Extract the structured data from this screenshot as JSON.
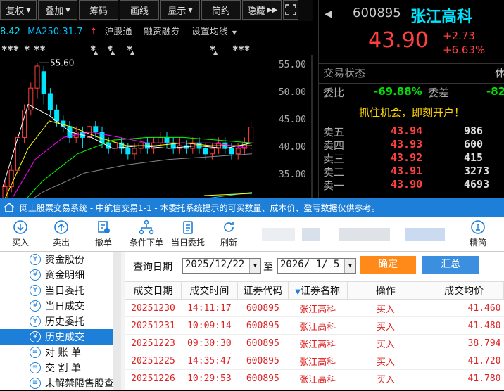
{
  "toolbar": {
    "items": [
      "复权",
      "叠加",
      "筹码",
      "画线",
      "显示",
      "简约",
      "隐藏"
    ],
    "more": "▶▶"
  },
  "ma_line": {
    "ma_partial": "8.42",
    "ma250": "MA250:31.7",
    "tabs": [
      "沪股通",
      "融资融券",
      "设置均线"
    ]
  },
  "chart": {
    "high_marker": "55.60",
    "price_ticks": [
      "55.00",
      "50.00",
      "45.00",
      "40.00",
      "35.00"
    ],
    "colors": {
      "up": "#ff4040",
      "down": "#00e5ff",
      "ma5": "#ffffff",
      "ma10": "#ffff00",
      "ma20": "#ff00ff",
      "ma60": "#00ff00",
      "ma250": "#00bfff"
    }
  },
  "quote": {
    "code": "600895",
    "name": "张江高科",
    "price": "43.90",
    "change": "+2.73",
    "change_pct": "+6.63%",
    "status_label": "交易状态",
    "status_value": "休",
    "weibi_label": "委比",
    "weibi_value": "-69.88%",
    "weicha_label": "委差",
    "weicha_value": "-82",
    "ad_text": "抓住机会，即刻开户！",
    "orderbook": [
      {
        "label": "卖五",
        "price": "43.94",
        "vol": "986"
      },
      {
        "label": "卖四",
        "price": "43.93",
        "vol": "600"
      },
      {
        "label": "卖三",
        "price": "43.92",
        "vol": "415"
      },
      {
        "label": "卖二",
        "price": "43.91",
        "vol": "3273"
      },
      {
        "label": "卖一",
        "price": "43.90",
        "vol": "4693"
      }
    ]
  },
  "trade": {
    "title": "网上股票交易系统 - 中航信交易1-1 - 本委托系统提示的可买数量、成本价、盈亏数据仅供参考。",
    "tools": [
      "买入",
      "卖出",
      "撤单",
      "条件下单",
      "当日委托",
      "刷新",
      "精简"
    ],
    "sidebar": [
      "资金股份",
      "资金明细",
      "当日委托",
      "当日成交",
      "历史委托",
      "历史成交",
      "对 账 单",
      "交 割 单",
      "未解禁限售股查"
    ],
    "selected_index": 5,
    "query": {
      "label": "查询日期",
      "from": "2025/12/22",
      "to_label": "至",
      "to": "2026/ 1/ 5",
      "confirm": "确定",
      "summary": "汇总"
    },
    "columns": [
      "成交日期",
      "成交时间",
      "证券代码",
      "证券名称",
      "操作",
      "成交均价"
    ],
    "rows": [
      [
        "20251230",
        "14:11:17",
        "600895",
        "张江高科",
        "买入",
        "41.460"
      ],
      [
        "20251231",
        "10:09:14",
        "600895",
        "张江高科",
        "买入",
        "41.480"
      ],
      [
        "20251223",
        "09:30:30",
        "600895",
        "张江高科",
        "买入",
        "38.794"
      ],
      [
        "20251225",
        "14:35:47",
        "600895",
        "张江高科",
        "买入",
        "41.720"
      ],
      [
        "20251226",
        "10:29:53",
        "600895",
        "张江高科",
        "买入",
        "41.780"
      ]
    ]
  }
}
